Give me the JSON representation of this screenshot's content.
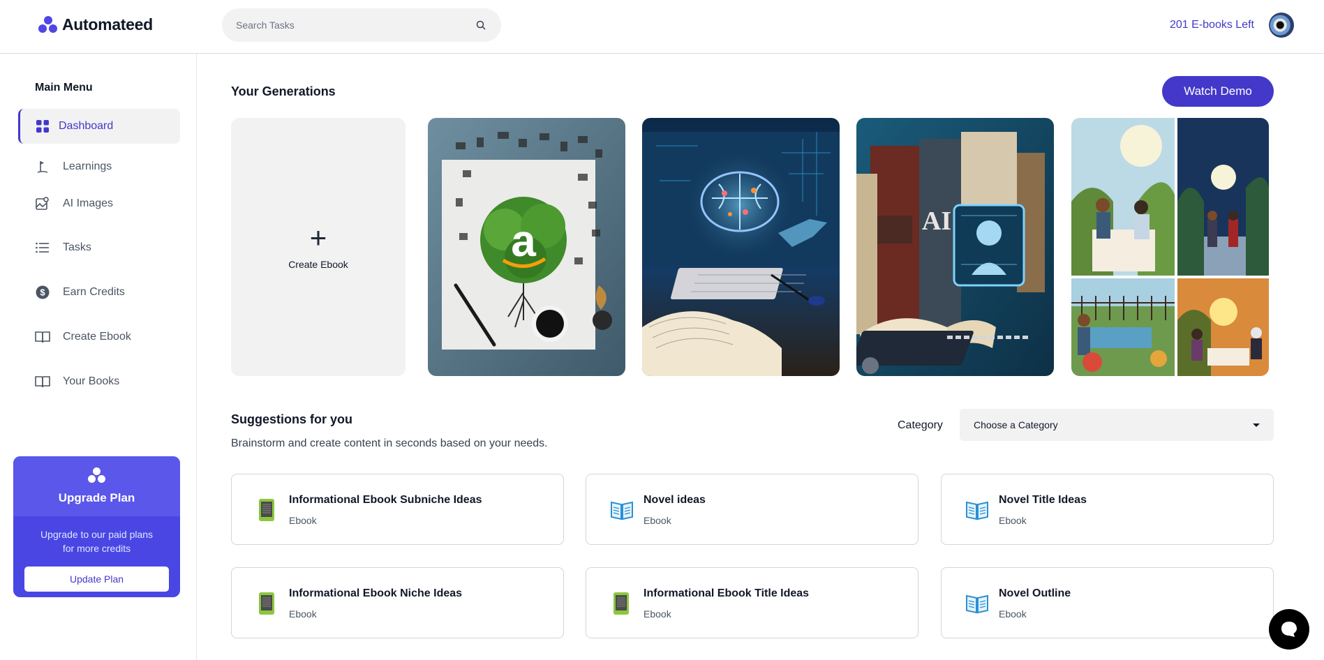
{
  "header": {
    "brand": "Automateed",
    "search_placeholder": "Search Tasks",
    "credits_left": "201 E-books Left"
  },
  "sidebar": {
    "menu_title": "Main Menu",
    "items": [
      {
        "label": "Dashboard",
        "icon": "grid-icon",
        "active": true
      },
      {
        "label": "Learnings",
        "icon": "golf-flag-icon"
      },
      {
        "label": "AI Images",
        "icon": "image-icon"
      },
      {
        "label": "Tasks",
        "icon": "list-icon"
      },
      {
        "label": "Earn Credits",
        "icon": "dollar-icon"
      },
      {
        "label": "Create Ebook",
        "icon": "book-icon"
      },
      {
        "label": "Your Books",
        "icon": "book-icon"
      }
    ],
    "upgrade": {
      "title": "Upgrade Plan",
      "description": "Upgrade to our paid plans for more credits",
      "button": "Update Plan"
    }
  },
  "generations": {
    "title": "Your Generations",
    "watch_demo": "Watch Demo",
    "create_label": "Create Ebook",
    "images": [
      "amazon-tree-book-cover",
      "ai-brain-computer-cover",
      "ai-books-cover",
      "couple-romance-collage-cover"
    ],
    "overlay_texts": [
      "a",
      "AI"
    ]
  },
  "suggestions": {
    "title": "Suggestions for you",
    "description": "Brainstorm and create content in seconds based on your needs.",
    "category_label": "Category",
    "category_value": "Choose a Category",
    "cards": [
      {
        "title": "Informational Ebook Subniche Ideas",
        "subtitle": "Ebook",
        "icon": "ebook-reader-icon"
      },
      {
        "title": "Novel ideas",
        "subtitle": "Ebook",
        "icon": "open-book-icon"
      },
      {
        "title": "Novel Title Ideas",
        "subtitle": "Ebook",
        "icon": "open-book-icon"
      },
      {
        "title": "Informational Ebook Niche Ideas",
        "subtitle": "Ebook",
        "icon": "ebook-reader-icon"
      },
      {
        "title": "Informational Ebook Title Ideas",
        "subtitle": "Ebook",
        "icon": "ebook-reader-icon"
      },
      {
        "title": "Novel Outline",
        "subtitle": "Ebook",
        "icon": "open-book-icon"
      }
    ]
  },
  "colors": {
    "accent": "#4338ca",
    "upgrade_bg": "#4a46e4",
    "card_bg": "#f2f2f3"
  }
}
